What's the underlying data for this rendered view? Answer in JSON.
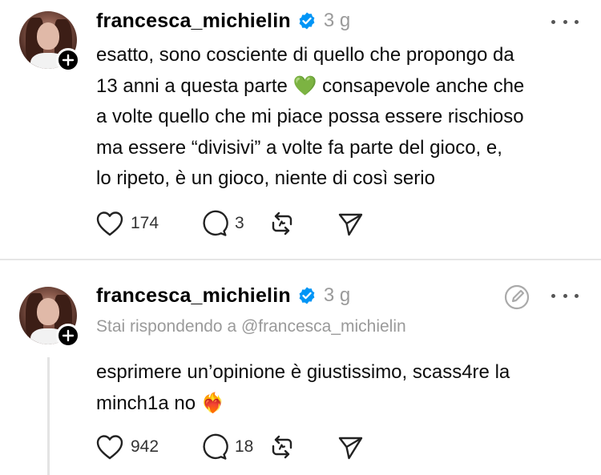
{
  "posts": [
    {
      "username": "francesca_michielin",
      "time": "3 g",
      "text_lines": [
        "esatto, sono cosciente di quello che propongo da",
        "13 anni a questa parte",
        "consapevole anche che",
        "a volte quello che mi piace possa essere rischioso",
        "ma essere “divisivi” a volte fa parte del gioco, e,",
        "lo ripeto, è un gioco, niente di così serio"
      ],
      "emoji": "💚",
      "likes": "174",
      "replies": "3"
    },
    {
      "username": "francesca_michielin",
      "time": "3 g",
      "reply_to": "Stai rispondendo a @francesca_michielin",
      "text_lines": [
        "esprimere un’opinione è giustissimo, scass4re la",
        "minch1a no"
      ],
      "emoji": "❤️‍🔥",
      "likes": "942",
      "replies": "18"
    }
  ],
  "icons": {
    "like": "heart-icon",
    "reply": "comment-bubble-icon",
    "repost": "repost-icon",
    "share": "send-icon",
    "more": "more-horizontal-icon",
    "verified": "verified-badge-icon",
    "edit": "quote-edit-icon",
    "follow": "plus-icon"
  },
  "colors": {
    "verified_blue": "#0095f6",
    "muted_gray": "#9a9a9a",
    "emoji_green": "#2fc24b"
  }
}
